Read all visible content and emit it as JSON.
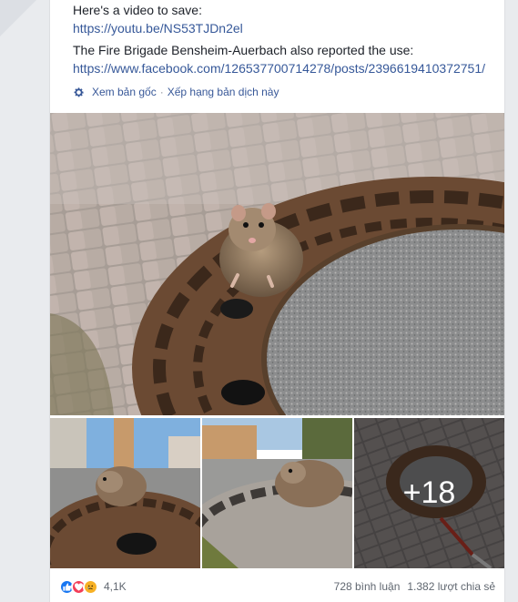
{
  "post": {
    "video_intro": "Here's a video to save:",
    "video_link": "https://youtu.be/NS53TJDn2el",
    "brigade_text": "The Fire Brigade Bensheim-Auerbach also reported the use:",
    "brigade_link": "https://www.facebook.com/126537700714278/posts/2396619410372751/"
  },
  "translation": {
    "see_original": "Xem bản gốc",
    "separator": "·",
    "rate_translation": "Xếp hạng bản dịch này"
  },
  "gallery": {
    "more_count": "+18"
  },
  "footer": {
    "reaction_count": "4,1K",
    "comments": "728 bình luận",
    "shares": "1.382 lượt chia sẻ"
  },
  "colors": {
    "link": "#365899",
    "like": "#1877f2",
    "love": "#f33e58",
    "sad": "#f7b125"
  },
  "icons": [
    "gear-icon",
    "like-reaction-icon",
    "love-reaction-icon",
    "sad-reaction-icon"
  ]
}
